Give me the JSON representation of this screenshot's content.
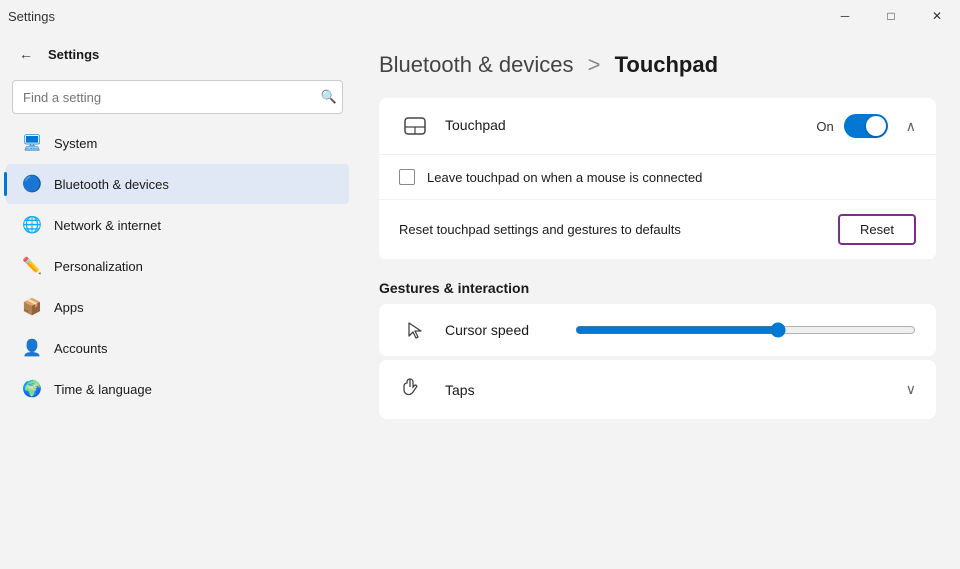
{
  "titlebar": {
    "title": "Settings",
    "minimize_label": "─",
    "maximize_label": "□",
    "close_label": "✕"
  },
  "sidebar": {
    "back_button_label": "←",
    "app_title": "Settings",
    "search": {
      "placeholder": "Find a setting",
      "icon": "🔍"
    },
    "nav_items": [
      {
        "id": "system",
        "label": "System",
        "icon": "🖥",
        "active": false
      },
      {
        "id": "bluetooth",
        "label": "Bluetooth & devices",
        "icon": "🔵",
        "active": true
      },
      {
        "id": "network",
        "label": "Network & internet",
        "icon": "🌐",
        "active": false
      },
      {
        "id": "personalization",
        "label": "Personalization",
        "icon": "✏️",
        "active": false
      },
      {
        "id": "apps",
        "label": "Apps",
        "icon": "📦",
        "active": false
      },
      {
        "id": "accounts",
        "label": "Accounts",
        "icon": "👤",
        "active": false
      },
      {
        "id": "time",
        "label": "Time & language",
        "icon": "🌍",
        "active": false
      }
    ]
  },
  "content": {
    "breadcrumb_parent": "Bluetooth & devices",
    "breadcrumb_separator": ">",
    "breadcrumb_current": "Touchpad",
    "touchpad_section": {
      "icon": "⬜",
      "label": "Touchpad",
      "toggle_label": "On",
      "toggle_on": true,
      "chevron": "∧"
    },
    "leave_touchpad_label": "Leave touchpad on when a mouse is connected",
    "reset_text": "Reset touchpad settings and gestures to defaults",
    "reset_button_label": "Reset",
    "gestures_title": "Gestures & interaction",
    "cursor_speed": {
      "icon": "↖",
      "label": "Cursor speed",
      "value": 60
    },
    "taps": {
      "icon": "👆",
      "label": "Taps",
      "chevron": "∨"
    }
  }
}
